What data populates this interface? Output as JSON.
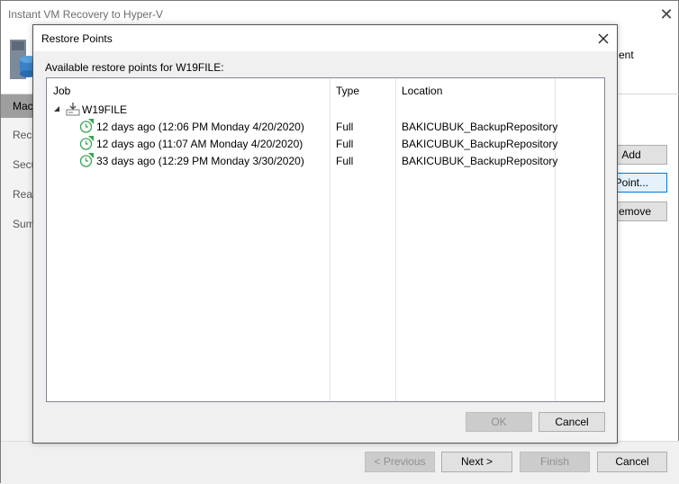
{
  "wizard": {
    "title": "Instant VM Recovery to Hyper-V",
    "header_text_fragment": "ent",
    "nav_items": [
      {
        "label": "Mac"
      },
      {
        "label": "Reco"
      },
      {
        "label": "Secu"
      },
      {
        "label": "Reas"
      },
      {
        "label": "Sum"
      }
    ],
    "side_buttons": {
      "add": "Add",
      "point": "Point...",
      "remove": "emove"
    },
    "footer": {
      "previous": "< Previous",
      "next": "Next >",
      "finish": "Finish",
      "cancel": "Cancel"
    }
  },
  "dialog": {
    "title": "Restore Points",
    "label": "Available restore points for W19FILE:",
    "columns": {
      "job": "Job",
      "type": "Type",
      "location": "Location"
    },
    "root": {
      "name": "W19FILE"
    },
    "rows": [
      {
        "job": "12 days ago (12:06 PM Monday 4/20/2020)",
        "type": "Full",
        "location": "BAKICUBUK_BackupRepository"
      },
      {
        "job": "12 days ago (11:07 AM Monday 4/20/2020)",
        "type": "Full",
        "location": "BAKICUBUK_BackupRepository"
      },
      {
        "job": "33 days ago (12:29 PM Monday 3/30/2020)",
        "type": "Full",
        "location": "BAKICUBUK_BackupRepository"
      }
    ],
    "buttons": {
      "ok": "OK",
      "cancel": "Cancel"
    }
  },
  "colors": {
    "accent": "#0078d7",
    "icon_green": "#3aa655",
    "nav_active": "#9e9e9e"
  }
}
